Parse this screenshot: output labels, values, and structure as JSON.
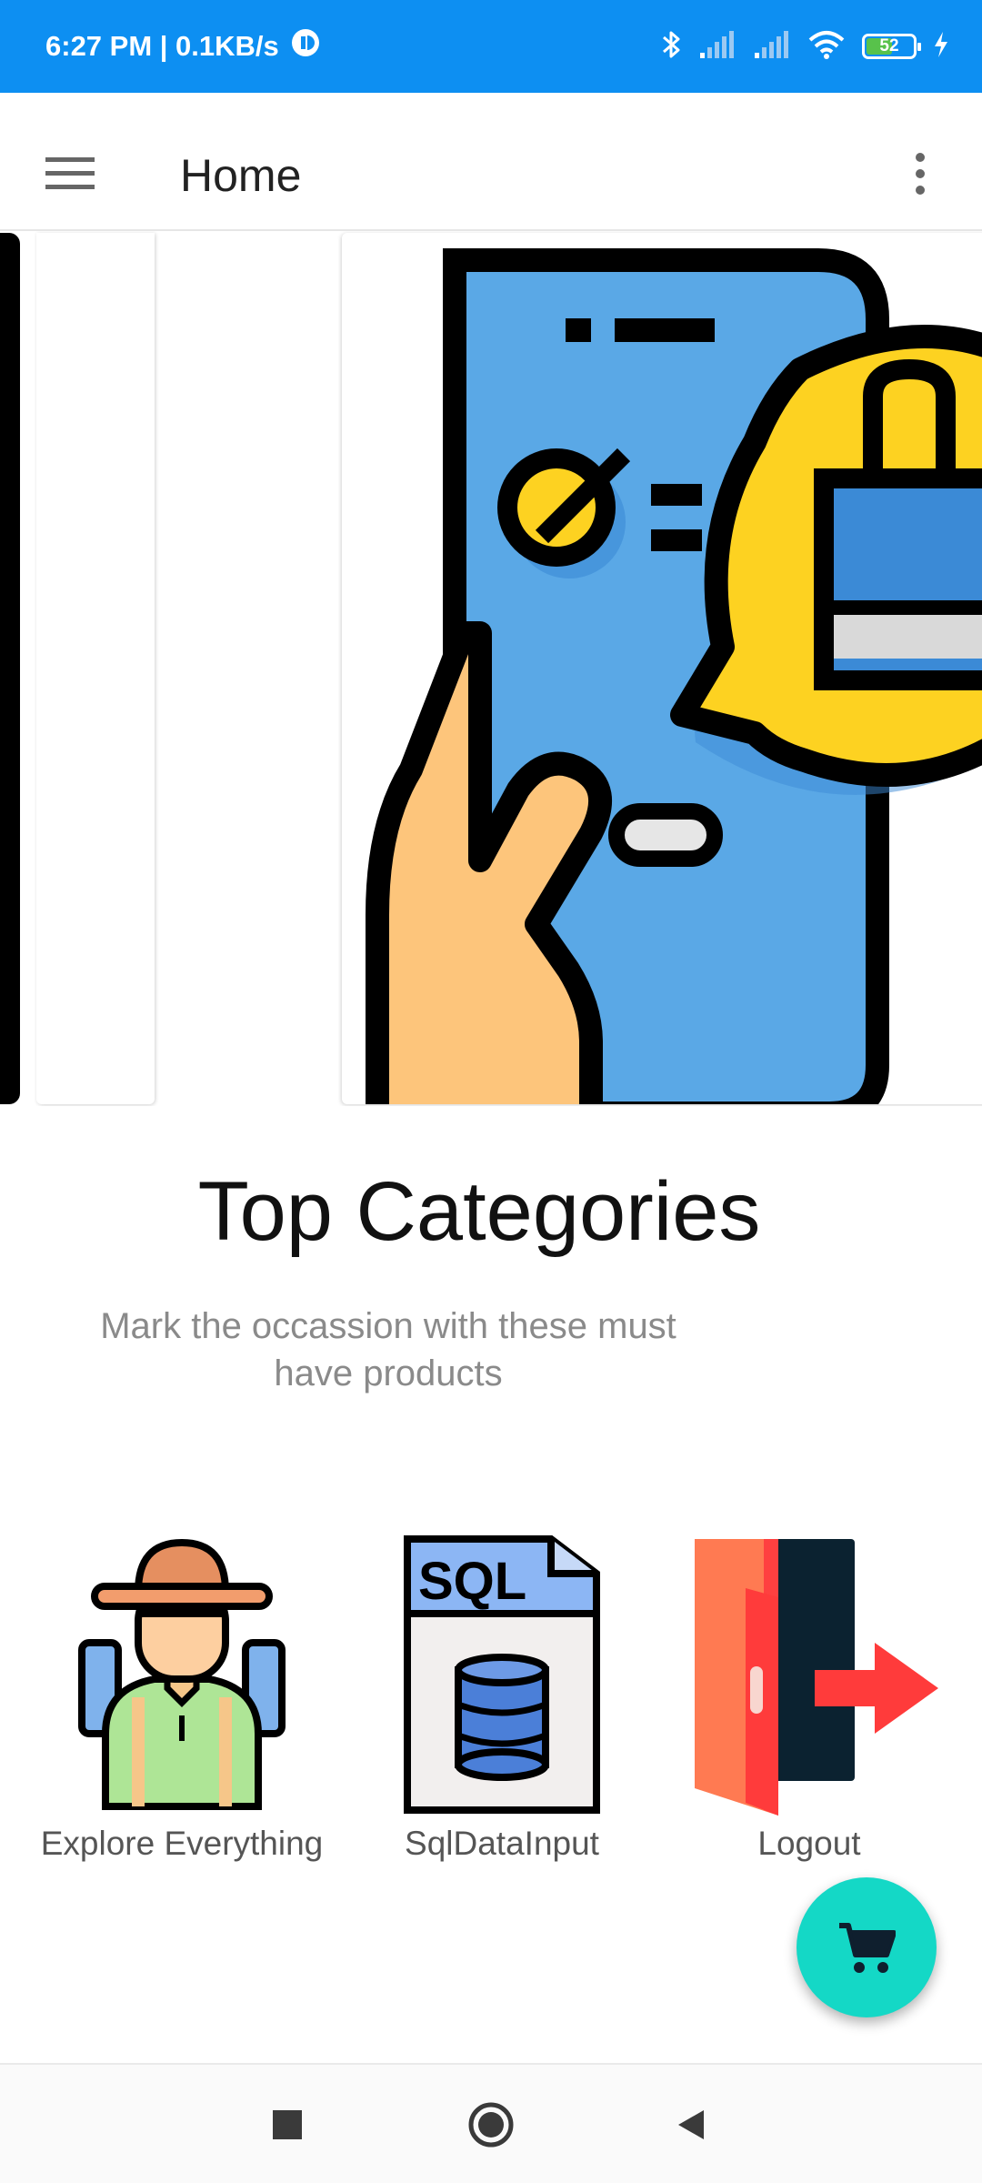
{
  "status_bar": {
    "time_speed": "6:27 PM | 0.1KB/s",
    "battery_level": "52",
    "icons": [
      "vpn-icon",
      "bluetooth-icon",
      "signal-icon",
      "signal-icon",
      "wifi-icon",
      "battery-icon",
      "charging-icon"
    ]
  },
  "app_bar": {
    "title": "Home",
    "menu_icon": "hamburger-menu-icon",
    "overflow_icon": "more-vertical-icon"
  },
  "carousel": {
    "banner_icon": "phone-shopping-bag-illustration"
  },
  "categories": {
    "title": "Top Categories",
    "subtitle": "Mark the occassion with these must have products",
    "items": [
      {
        "label": "Explore Everything",
        "icon": "explorer-icon"
      },
      {
        "label": "SqlDataInput",
        "icon": "sql-database-icon"
      },
      {
        "label": "Logout",
        "icon": "logout-door-icon"
      }
    ]
  },
  "fab": {
    "icon": "cart-icon"
  },
  "nav_bar": {
    "icons": [
      "recents-square-icon",
      "home-circle-icon",
      "back-triangle-icon"
    ]
  },
  "colors": {
    "status_bar": "#0d8ff2",
    "fab": "#14d8c6",
    "phone_blue": "#5aa8e6",
    "bubble_yellow": "#fdd221",
    "hand_skin": "#fdc57b"
  }
}
